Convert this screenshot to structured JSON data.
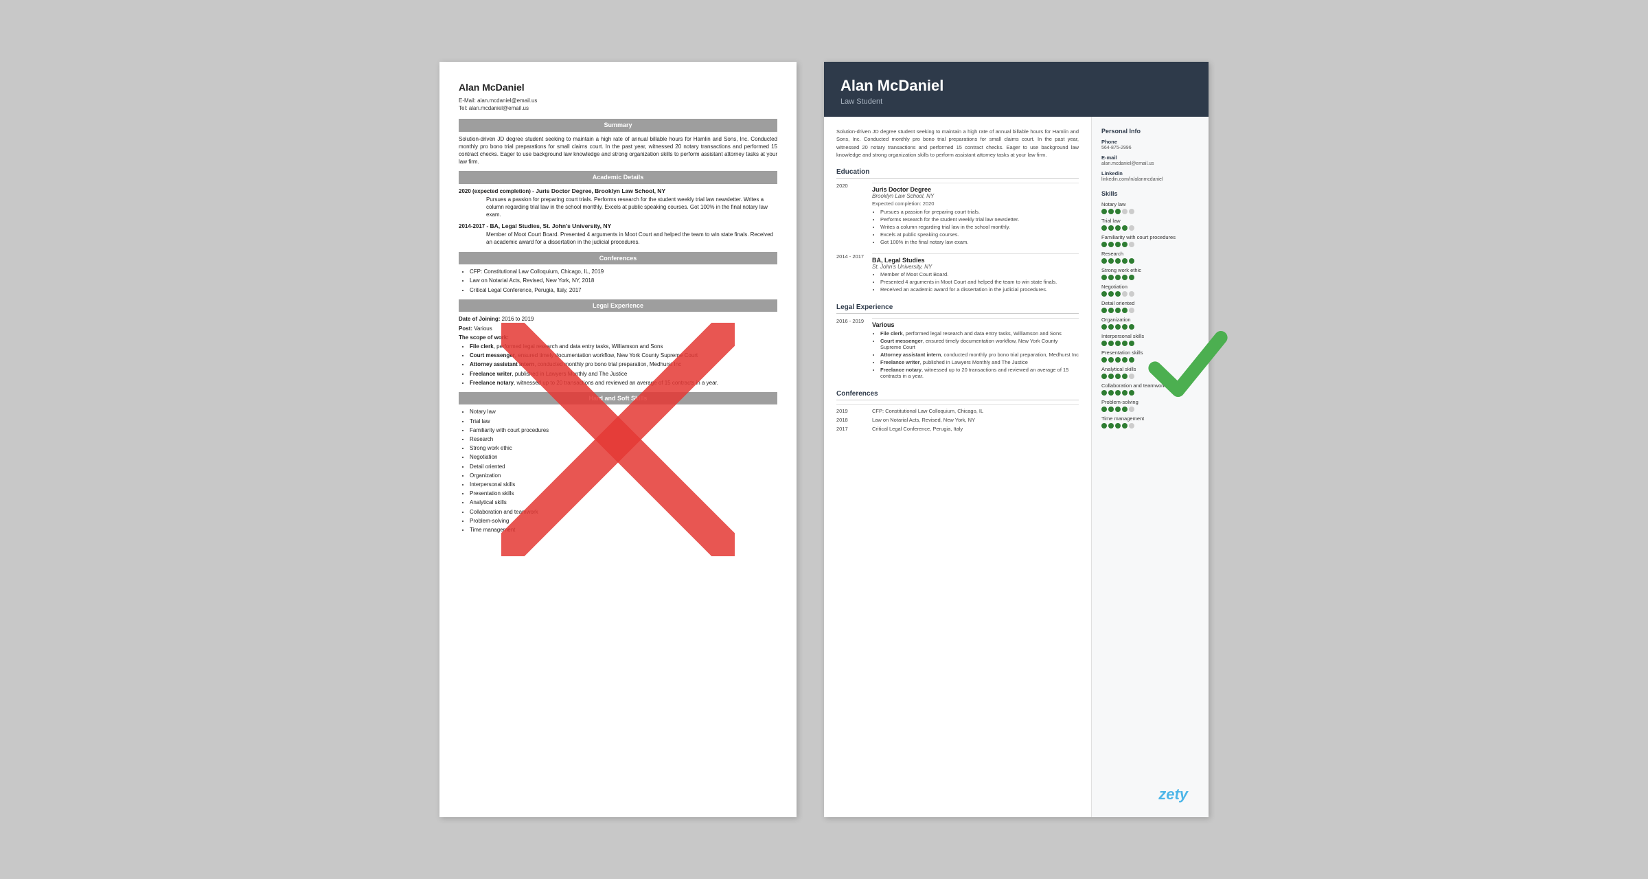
{
  "left_resume": {
    "name": "Alan McDaniel",
    "email_label": "E-Mail:",
    "email": "alan.mcdaniel@email.us",
    "tel_label": "Tel:",
    "tel": "alan.mcdaniel@email.us",
    "summary_header": "Summary",
    "summary_text": "Solution-driven JD degree student seeking to maintain a high rate of annual billable hours for Hamlin and Sons, Inc. Conducted monthly pro bono trial preparations for small claims court. In the past year, witnessed 20 notary transactions and performed 15 contract checks. Eager to use background law knowledge and strong organization skills to perform assistant attorney tasks at your law firm.",
    "academic_header": "Academic Details",
    "edu1_year": "2020 (expected completion) -",
    "edu1_title": "Juris Doctor Degree, Brooklyn Law School, NY",
    "edu1_bullets": [
      "Pursues a passion for preparing court trials. Performs research for the student weekly trial law newsletter. Writes a column regarding trial law in the school monthly. Excels at public speaking courses. Got 100% in the final notary law exam."
    ],
    "edu2_year": "2014-2017 -",
    "edu2_title": "BA, Legal Studies, St. John's University, NY",
    "edu2_bullets": [
      "Member of Moot Court Board. Presented 4 arguments in Moot Court and helped the team to win state finals. Received an academic award for a dissertation in the judicial procedures."
    ],
    "conferences_header": "Conferences",
    "conferences": [
      "CFP: Constitutional Law Colloquium, Chicago, IL, 2019",
      "Law on Notarial Acts, Revised, New York, NY, 2018",
      "Critical Legal Conference, Perugia, Italy, 2017"
    ],
    "legal_header": "Legal Experience",
    "legal_date": "Date of Joining: 2016 to 2019",
    "legal_post": "Post: Various",
    "legal_scope": "The scope of work:",
    "legal_bullets": [
      "File clerk, performed legal research and data entry tasks, Williamson and Sons",
      "Court messenger, ensured timely documentation workflow, New York County Supreme Court",
      "Attorney assistant intern, conducted monthly pro bono trial preparation, Medhurst Inc",
      "Freelance writer, published in Lawyers Monthly and The Justice",
      "Freelance notary, witnessed up to 20 transactions and reviewed an average of 15 contracts in a year."
    ],
    "skills_header": "Hard and Soft Skills",
    "skills": [
      "Notary law",
      "Trial law",
      "Familiarity with court procedures",
      "Research",
      "Strong work ethic",
      "Negotiation",
      "Detail oriented",
      "Organization",
      "Interpersonal skills",
      "Presentation skills",
      "Analytical skills",
      "Collaboration and teamwork",
      "Problem-solving",
      "Time management"
    ]
  },
  "right_resume": {
    "name": "Alan McDaniel",
    "title": "Law Student",
    "summary_text": "Solution-driven JD degree student seeking to maintain a high rate of annual billable hours for Hamlin and Sons, Inc. Conducted monthly pro bono trial preparations for small claims court. In the past year, witnessed 20 notary transactions and performed 15 contract checks. Eager to use background law knowledge and strong organization skills to perform assistant attorney tasks at your law firm.",
    "education_header": "Education",
    "edu": [
      {
        "year": "2020",
        "degree": "Juris Doctor Degree",
        "school": "Brooklyn Law School, NY",
        "expected": "Expected completion: 2020",
        "bullets": [
          "Pursues a passion for preparing court trials.",
          "Performs research for the student weekly trial law newsletter.",
          "Writes a column regarding trial law in the school monthly.",
          "Excels at public speaking courses.",
          "Got 100% in the final notary law exam."
        ]
      },
      {
        "year": "2014 - 2017",
        "degree": "BA, Legal Studies",
        "school": "St. John's University, NY",
        "expected": "",
        "bullets": [
          "Member of Moot Court Board.",
          "Presented 4 arguments in Moot Court and helped the team to win state finals.",
          "Received an academic award for a dissertation in the judicial procedures."
        ]
      }
    ],
    "legal_header": "Legal Experience",
    "legal": [
      {
        "year": "2016 - 2019",
        "place": "Various",
        "bullets": [
          "File clerk, performed legal research and data entry tasks, Williamson and Sons",
          "Court messenger, ensured timely documentation workflow, New York County Supreme Court",
          "Attorney assistant intern, conducted monthly pro bono trial preparation, Medhurst Inc",
          "Freelance writer, published in Lawyers Monthly and The Justice",
          "Freelance notary, witnessed up to 20 transactions and reviewed an average of 15 contracts in a year."
        ]
      }
    ],
    "conferences_header": "Conferences",
    "conferences": [
      {
        "year": "2019",
        "text": "CFP: Constitutional Law Colloquium, Chicago, IL"
      },
      {
        "year": "2018",
        "text": "Law on Notarial Acts, Revised, New York, NY"
      },
      {
        "year": "2017",
        "text": "Critical Legal Conference, Perugia, Italy"
      }
    ],
    "personal_header": "Personal Info",
    "phone_label": "Phone",
    "phone": "564-875-2996",
    "email_label": "E-mail",
    "email": "alan.mcdaniel@email.us",
    "linkedin_label": "Linkedin",
    "linkedin": "linkedin.com/in/alanmcdaniel",
    "skills_header": "Skills",
    "skills": [
      {
        "name": "Notary law",
        "filled": 3,
        "total": 5
      },
      {
        "name": "Trial law",
        "filled": 4,
        "total": 5
      },
      {
        "name": "Familiarity with court procedures",
        "filled": 4,
        "total": 5
      },
      {
        "name": "Research",
        "filled": 5,
        "total": 5
      },
      {
        "name": "Strong work ethic",
        "filled": 5,
        "total": 5
      },
      {
        "name": "Negotiation",
        "filled": 3,
        "total": 5
      },
      {
        "name": "Detail oriented",
        "filled": 4,
        "total": 5
      },
      {
        "name": "Organization",
        "filled": 5,
        "total": 5
      },
      {
        "name": "Interpersonal skills",
        "filled": 5,
        "total": 5
      },
      {
        "name": "Presentation skills",
        "filled": 5,
        "total": 5
      },
      {
        "name": "Analytical skills",
        "filled": 4,
        "total": 5
      },
      {
        "name": "Collaboration and teamwork",
        "filled": 5,
        "total": 5
      },
      {
        "name": "Problem-solving",
        "filled": 4,
        "total": 5
      },
      {
        "name": "Time management",
        "filled": 4,
        "total": 5
      }
    ]
  },
  "watermark": "zety"
}
